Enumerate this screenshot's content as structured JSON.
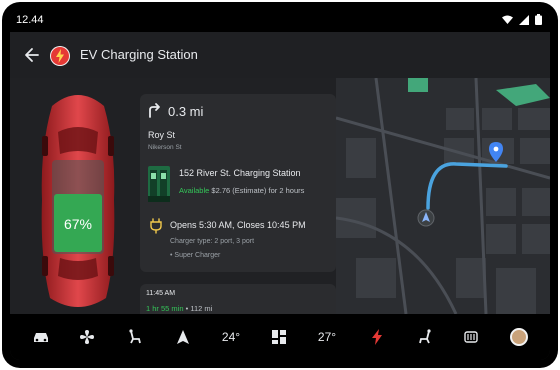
{
  "status_bar": {
    "time": "12.44"
  },
  "header": {
    "title": "EV Charging Station"
  },
  "car": {
    "battery_percent": "67%"
  },
  "directions": {
    "distance": "0.3 mi",
    "street": "Roy St",
    "cross_street": "Nikerson St"
  },
  "station": {
    "name": "152 River St. Charging Station",
    "availability": "Available",
    "price": "$2.76 (Estimate) for 2 hours",
    "hours": "Opens 5:30 AM, Closes 10:45 PM",
    "charger_type": "Charger type: 2 port, 3 port",
    "super_charger": "• Super Charger"
  },
  "trip": {
    "arrival": "11:45 AM",
    "duration": "1 hr 55 min",
    "distance": "• 112 mi"
  },
  "navbar": {
    "temp_left": "24°",
    "temp_right": "27°"
  },
  "colors": {
    "accent_green": "#34c759",
    "charging_red": "#e53935",
    "map_route": "#4aa3df"
  }
}
